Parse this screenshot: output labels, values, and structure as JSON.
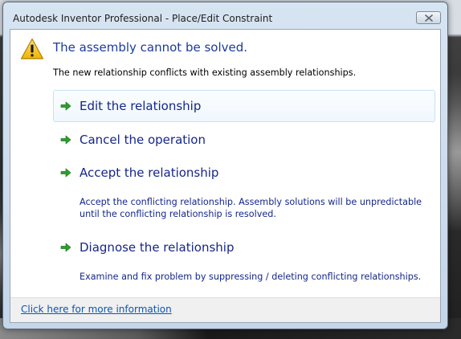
{
  "window": {
    "title": "Autodesk Inventor Professional - Place/Edit Constraint"
  },
  "dialog": {
    "main_instruction": "The assembly cannot be solved.",
    "content": "The new relationship conflicts with existing assembly relationships.",
    "commands": [
      {
        "label": "Edit the relationship",
        "note": ""
      },
      {
        "label": "Cancel the operation",
        "note": ""
      },
      {
        "label": "Accept the relationship",
        "note": "Accept the conflicting relationship. Assembly solutions will be unpredictable until the conflicting relationship is resolved."
      },
      {
        "label": "Diagnose the relationship",
        "note": "Examine and fix problem by suppressing / deleting conflicting relationships."
      }
    ],
    "footer_link": "Click here for more information"
  },
  "icons": {
    "warning": "warning-icon",
    "command_arrow": "green-arrow-right-icon",
    "close": "close-icon"
  },
  "colors": {
    "main_instruction": "#1c3a9e",
    "command_text": "#15268a",
    "arrow_green": "#2e9e2e",
    "link": "#0b55b3"
  }
}
